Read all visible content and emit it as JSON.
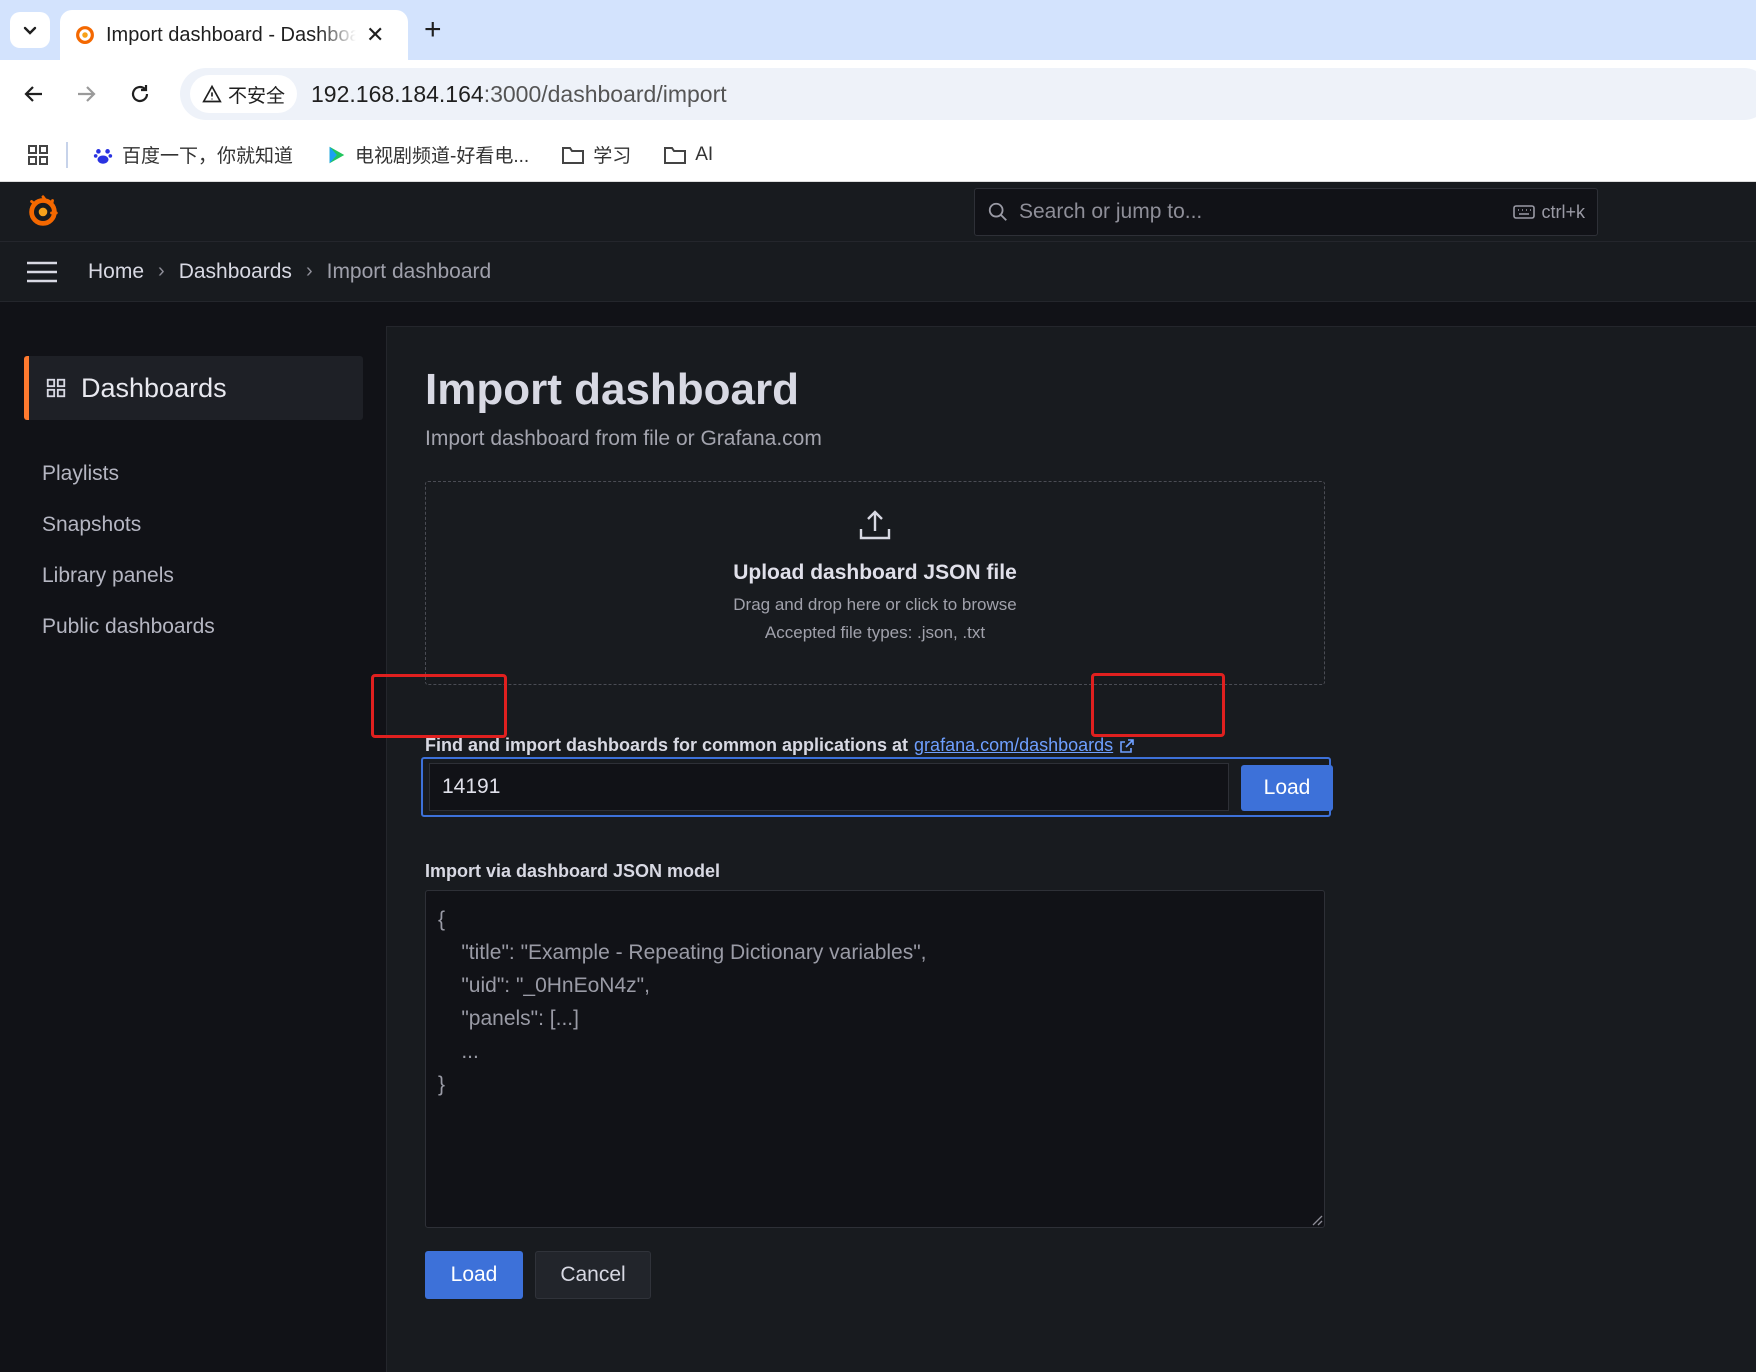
{
  "browser": {
    "tab_title": "Import dashboard - Dashboards - Grafana",
    "tab_close": "✕",
    "new_tab": "+",
    "insecure_label": "不安全",
    "url_host": "192.168.184.164",
    "url_rest": ":3000/dashboard/import",
    "bookmarks": [
      {
        "label": "百度一下，你就知道",
        "icon": "baidu-icon"
      },
      {
        "label": "电视剧频道-好看电...",
        "icon": "video-icon"
      },
      {
        "label": "学习",
        "icon": "folder-icon"
      },
      {
        "label": "AI",
        "icon": "folder-icon"
      }
    ]
  },
  "grafana": {
    "search_placeholder": "Search or jump to...",
    "search_shortcut": "ctrl+k",
    "breadcrumbs": [
      "Home",
      "Dashboards",
      "Import dashboard"
    ],
    "crumb_sep": "›"
  },
  "sidebar": {
    "active": "Dashboards",
    "items": [
      "Playlists",
      "Snapshots",
      "Library panels",
      "Public dashboards"
    ]
  },
  "main": {
    "title": "Import dashboard",
    "subtitle": "Import dashboard from file or Grafana.com",
    "upload_title": "Upload dashboard JSON file",
    "upload_hint": "Drag and drop here or click to browse",
    "upload_types": "Accepted file types: .json, .txt",
    "gcom_label": "Find and import dashboards for common applications at",
    "gcom_link": "grafana.com/dashboards",
    "gcom_value": "14191",
    "gcom_load": "Load",
    "json_label": "Import via dashboard JSON model",
    "json_placeholder": "{\n    \"title\": \"Example - Repeating Dictionary variables\",\n    \"uid\": \"_0HnEoN4z\",\n    \"panels\": [...]\n    ...\n}",
    "load_button": "Load",
    "cancel_button": "Cancel"
  },
  "colors": {
    "accent": "#3d71d9",
    "highlight": "#e0201f",
    "active_marker": "#ff7a2f"
  }
}
